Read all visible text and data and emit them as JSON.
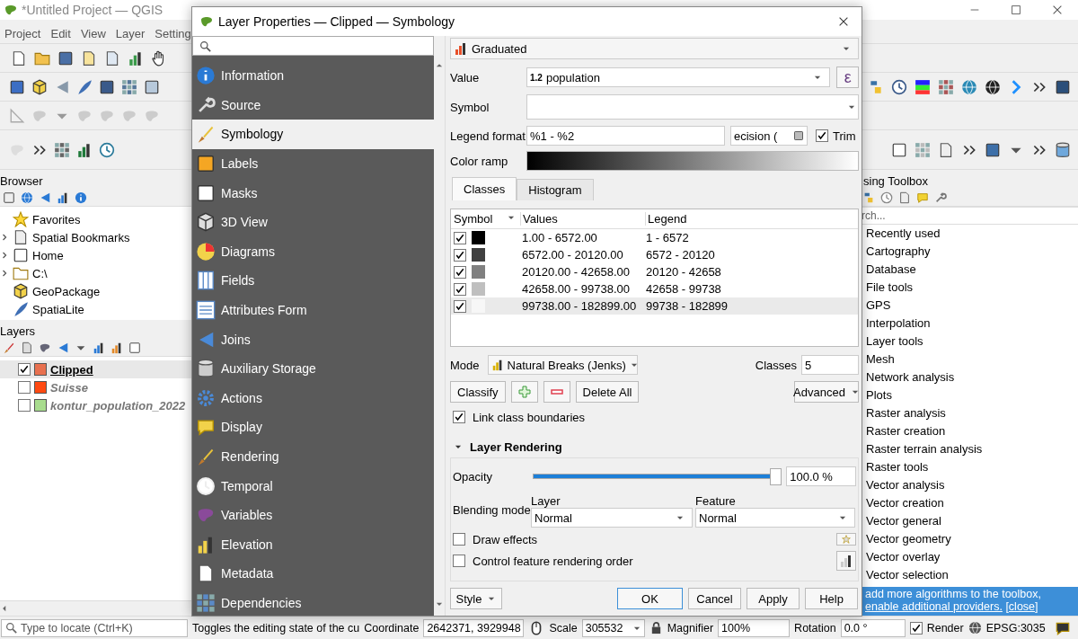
{
  "app": {
    "title": "*Untitled Project — QGIS",
    "menu": [
      "Project",
      "Edit",
      "View",
      "Layer",
      "Setting"
    ]
  },
  "browser": {
    "title": "Browser",
    "items": [
      {
        "label": "Favorites",
        "expandable": false
      },
      {
        "label": "Spatial Bookmarks",
        "expandable": true
      },
      {
        "label": "Home",
        "expandable": true
      },
      {
        "label": "C:\\",
        "expandable": true
      },
      {
        "label": "GeoPackage",
        "expandable": false
      },
      {
        "label": "SpatiaLite",
        "expandable": false
      }
    ]
  },
  "layers": {
    "title": "Layers",
    "items": [
      {
        "name": "Clipped",
        "checked": true,
        "selected": true,
        "color": "#e8704f"
      },
      {
        "name": "Suisse",
        "checked": false,
        "selected": false,
        "color": "#ff4a12"
      },
      {
        "name": "kontur_population_2022",
        "checked": false,
        "selected": false,
        "color": "#a8dc8e"
      }
    ]
  },
  "toolbox": {
    "title": "sing Toolbox",
    "placeholder": "rch...",
    "items": [
      "Recently used",
      "Cartography",
      "Database",
      "File tools",
      "GPS",
      "Interpolation",
      "Layer tools",
      "Mesh",
      "Network analysis",
      "Plots",
      "Raster analysis",
      "Raster creation",
      "Raster terrain analysis",
      "Raster tools",
      "Vector analysis",
      "Vector creation",
      "Vector general",
      "Vector geometry",
      "Vector overlay",
      "Vector selection"
    ],
    "notice": {
      "text": "add more algorithms to the toolbox,",
      "link": "enable additional providers.",
      "close": "[close]"
    }
  },
  "dialog": {
    "title": "Layer Properties — Clipped — Symbology",
    "pages": [
      {
        "label": "Information",
        "selected": false
      },
      {
        "label": "Source",
        "selected": false
      },
      {
        "label": "Symbology",
        "selected": true
      },
      {
        "label": "Labels",
        "selected": false
      },
      {
        "label": "Masks",
        "selected": false
      },
      {
        "label": "3D View",
        "selected": false
      },
      {
        "label": "Diagrams",
        "selected": false
      },
      {
        "label": "Fields",
        "selected": false
      },
      {
        "label": "Attributes Form",
        "selected": false
      },
      {
        "label": "Joins",
        "selected": false
      },
      {
        "label": "Auxiliary Storage",
        "selected": false
      },
      {
        "label": "Actions",
        "selected": false
      },
      {
        "label": "Display",
        "selected": false
      },
      {
        "label": "Rendering",
        "selected": false
      },
      {
        "label": "Temporal",
        "selected": false
      },
      {
        "label": "Variables",
        "selected": false
      },
      {
        "label": "Elevation",
        "selected": false
      },
      {
        "label": "Metadata",
        "selected": false
      },
      {
        "label": "Dependencies",
        "selected": false
      }
    ],
    "renderer": "Graduated",
    "value_label": "Value",
    "value_type": "1.2",
    "value": "population",
    "expression_button": "ε",
    "symbol_label": "Symbol",
    "legend_format_label": "Legend format",
    "legend_format": "%1 - %2",
    "precision": "ecision (",
    "trim_label": "Trim",
    "trim": true,
    "color_ramp_label": "Color ramp",
    "tabs": [
      {
        "label": "Classes",
        "selected": true
      },
      {
        "label": "Histogram",
        "selected": false
      }
    ],
    "classes": {
      "columns": [
        "Symbol",
        "Values",
        "Legend"
      ],
      "rows": [
        {
          "checked": true,
          "color": "#000000",
          "values": "1.00 - 6572.00",
          "legend": "1 - 6572",
          "selected": false
        },
        {
          "checked": true,
          "color": "#404040",
          "values": "6572.00 - 20120.00",
          "legend": "6572 - 20120",
          "selected": false
        },
        {
          "checked": true,
          "color": "#808080",
          "values": "20120.00 - 42658.00",
          "legend": "20120 - 42658",
          "selected": false
        },
        {
          "checked": true,
          "color": "#bfbfbf",
          "values": "42658.00 - 99738.00",
          "legend": "42658 - 99738",
          "selected": false
        },
        {
          "checked": true,
          "color": "#f7f7f7",
          "values": "99738.00 - 182899.00",
          "legend": "99738 - 182899",
          "selected": true
        }
      ]
    },
    "mode_label": "Mode",
    "mode": "Natural Breaks (Jenks)",
    "classes_label": "Classes",
    "class_count": "5",
    "buttons": {
      "classify": "Classify",
      "delete_all": "Delete All",
      "advanced": "Advanced"
    },
    "link_label": "Link class boundaries",
    "link": true,
    "rendering": {
      "title": "Layer Rendering",
      "expanded": true,
      "opacity_label": "Opacity",
      "opacity": {
        "level": 1.0
      },
      "opacity_value": "100.0 %",
      "blending_label": "Blending mode",
      "layer_label": "Layer",
      "layer_mode": "Normal",
      "feature_label": "Feature",
      "feature_mode": "Normal",
      "draw_effects_label": "Draw effects",
      "draw_effects": false,
      "order_label": "Control feature rendering order",
      "order": false
    },
    "footer": {
      "style": "Style",
      "ok": "OK",
      "cancel": "Cancel",
      "apply": "Apply",
      "help": "Help"
    }
  },
  "status_bar": {
    "locator_placeholder": "Type to locate (Ctrl+K)",
    "message": "Toggles the editing state of the cu",
    "coordinate_label": "Coordinate",
    "coordinate": "2642371, 3929948",
    "scale_label": "Scale",
    "scale": "305532",
    "magnifier_label": "Magnifier",
    "magnifier": "100%",
    "rotation_label": "Rotation",
    "rotation": "0.0 °",
    "render_label": "Render",
    "render": true,
    "crs": "EPSG:3035"
  }
}
